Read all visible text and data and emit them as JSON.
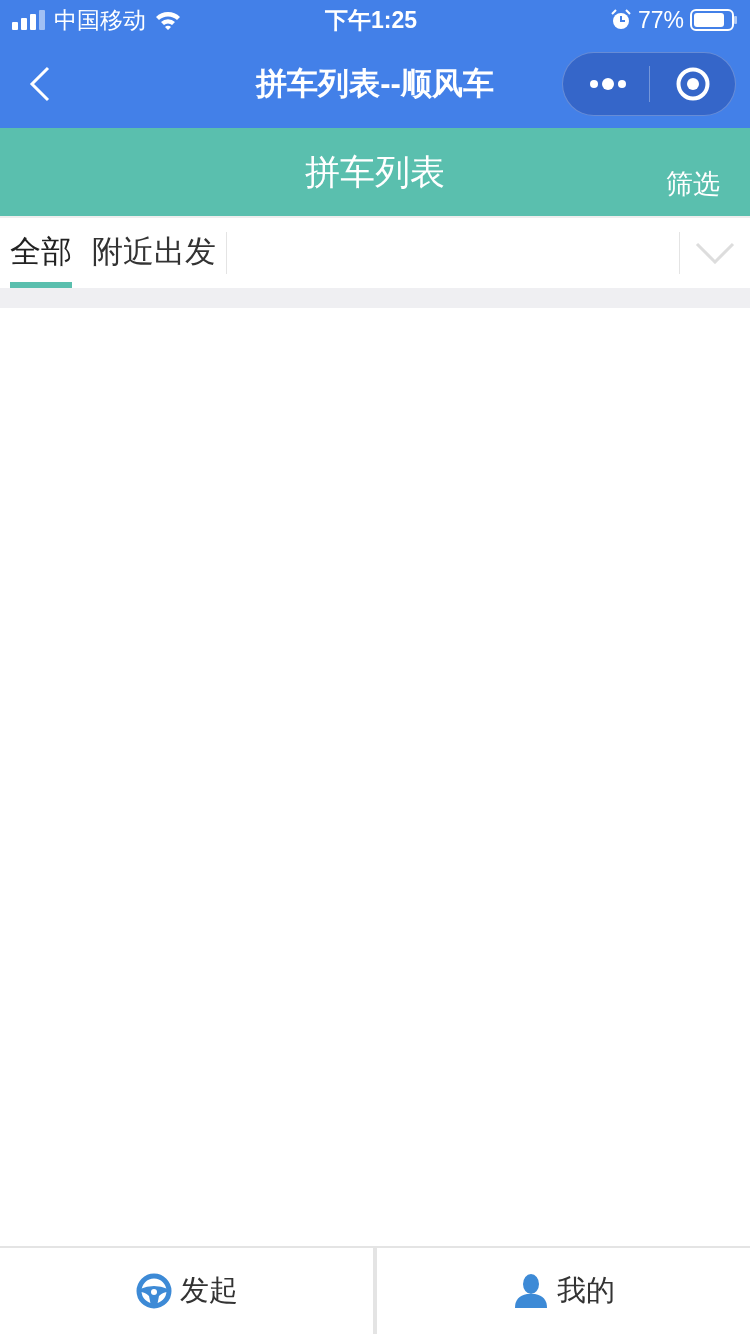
{
  "status_bar": {
    "carrier": "中国移动",
    "time": "下午1:25",
    "battery": "77%"
  },
  "nav_bar": {
    "title": "拼车列表--顺风车"
  },
  "header": {
    "title": "拼车列表",
    "filter": "筛选"
  },
  "tabs": [
    {
      "label": "全部",
      "selected": true
    },
    {
      "label": "附近出发",
      "selected": false
    }
  ],
  "bottom_bar": [
    {
      "kind": "wheel",
      "label": "发起"
    },
    {
      "kind": "person",
      "label": "我的"
    }
  ]
}
